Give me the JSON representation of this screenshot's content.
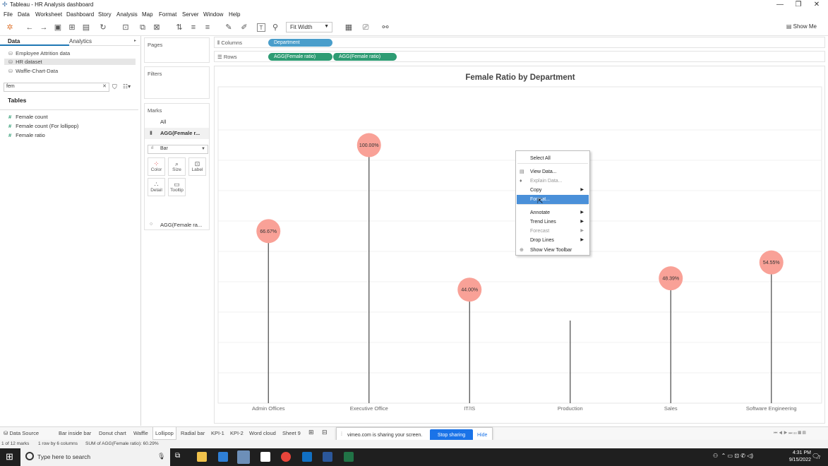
{
  "window": {
    "title": "Tableau - HR Analysis dashboard",
    "controls": [
      "—",
      "❐",
      "✕"
    ]
  },
  "menu": [
    "File",
    "Data",
    "Worksheet",
    "Dashboard",
    "Story",
    "Analysis",
    "Map",
    "Format",
    "Server",
    "Window",
    "Help"
  ],
  "toolbar": {
    "fit": "Fit Width",
    "show_me": "Show Me"
  },
  "datapane": {
    "tabs": [
      "Data",
      "Analytics"
    ],
    "sources": [
      "Employee Attrition data",
      "HR dataset",
      "Waffle-Chart-Data"
    ],
    "search_value": "fem",
    "tables_header": "Tables",
    "fields": [
      "Female count",
      "Female count (For lollipop)",
      "Female ratio"
    ]
  },
  "cards": {
    "pages": "Pages",
    "filters": "Filters",
    "marks": "Marks",
    "all": "All",
    "agg1": "AGG(Female r...",
    "mark_type": "Bar",
    "buttons": [
      "Color",
      "Size",
      "Label",
      "Detail",
      "Tooltip"
    ],
    "agg2": "AGG(Female ra..."
  },
  "shelves": {
    "columns_label": "Columns",
    "rows_label": "Rows",
    "columns_pill": "Department",
    "rows_pills": [
      "AGG(Female ratio)",
      "AGG(Female ratio)"
    ]
  },
  "chart_data": {
    "type": "lollipop",
    "title": "Female Ratio by Department",
    "categories": [
      "Admin Offices",
      "Executive Office",
      "IT/IS",
      "Production",
      "Sales",
      "Software Engineering"
    ],
    "values": [
      66.67,
      100.0,
      44.0,
      null,
      48.39,
      54.55
    ],
    "labels": [
      "66.67%",
      "100.00%",
      "44.00%",
      "",
      "48.39%",
      "54.55%"
    ],
    "ylim": [
      0,
      110
    ],
    "grid": true,
    "color": "#f9a197"
  },
  "context_menu": {
    "items": [
      {
        "label": "Select All",
        "icon": "",
        "submenu": false,
        "disabled": false,
        "highlight": false
      },
      {
        "label": "View Data...",
        "icon": "▤",
        "submenu": false,
        "disabled": false,
        "highlight": false
      },
      {
        "label": "Explain Data...",
        "icon": "♦",
        "submenu": false,
        "disabled": true,
        "highlight": false
      },
      {
        "label": "Copy",
        "icon": "",
        "submenu": true,
        "disabled": false,
        "highlight": false
      },
      {
        "label": "Format...",
        "icon": "",
        "submenu": false,
        "disabled": false,
        "highlight": true
      },
      {
        "label": "Annotate",
        "icon": "",
        "submenu": true,
        "disabled": false,
        "highlight": false
      },
      {
        "label": "Trend Lines",
        "icon": "",
        "submenu": true,
        "disabled": false,
        "highlight": false
      },
      {
        "label": "Forecast",
        "icon": "",
        "submenu": true,
        "disabled": true,
        "highlight": false
      },
      {
        "label": "Drop Lines",
        "icon": "",
        "submenu": true,
        "disabled": false,
        "highlight": false
      },
      {
        "label": "Show View Toolbar",
        "icon": "⊕",
        "submenu": false,
        "disabled": false,
        "highlight": false
      }
    ]
  },
  "sheet_tabs": {
    "data_source": "Data Source",
    "tabs": [
      "Bar inside bar",
      "Donut chart",
      "Waffle",
      "Lollipop",
      "Radial bar",
      "KPI-1",
      "KPI-2",
      "Word cloud",
      "Sheet 9"
    ],
    "active": "Lollipop"
  },
  "share_banner": {
    "text": "vimeo.com is sharing your screen.",
    "stop": "Stop sharing",
    "hide": "Hide"
  },
  "status": {
    "marks": "1 of 12 marks",
    "dims": "1 row by 6 columns",
    "sum": "SUM of AGG(Female ratio): 60.29%"
  },
  "taskbar": {
    "search_placeholder": "Type here to search",
    "time": "4:31 PM",
    "date": "9/15/2022",
    "notifications": "7"
  }
}
